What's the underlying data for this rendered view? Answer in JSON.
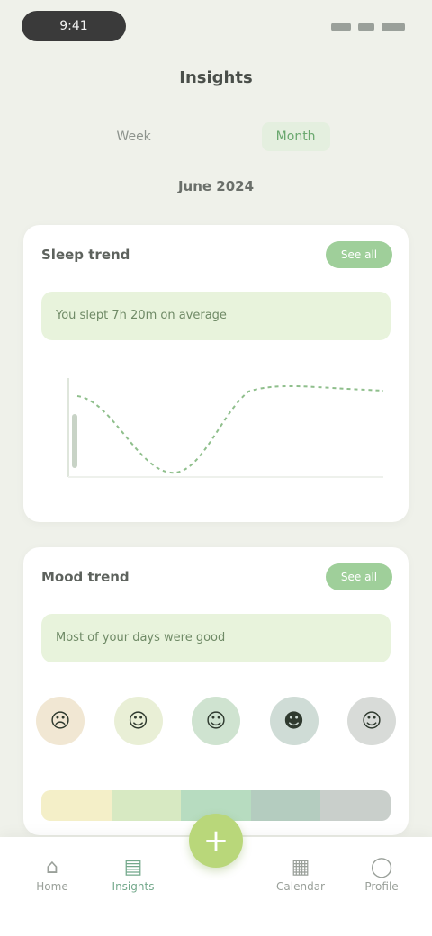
{
  "status_bar": {
    "time": "9:41"
  },
  "header": {
    "title": "Insights",
    "tabs": [
      {
        "label": "Week",
        "active": false
      },
      {
        "label": "Month",
        "active": true
      }
    ],
    "date_range": "June 2024"
  },
  "sleep_card": {
    "title": "Sleep trend",
    "badge": "See all",
    "insight": "You slept 7h 20m on average",
    "chart_type": "line",
    "line_color": "#8fbf8c"
  },
  "mood_card": {
    "title": "Mood trend",
    "badge": "See all",
    "insight": "Most of your days were good",
    "moods": [
      {
        "icon": "sad-face-icon",
        "glyph": "☹",
        "color": "#f1e7d3"
      },
      {
        "icon": "neutral-face-icon",
        "glyph": "😐",
        "color": "#e9efd6"
      },
      {
        "icon": "smile-face-icon",
        "glyph": "☺",
        "color": "#cfe3d0"
      },
      {
        "icon": "happy-face-icon",
        "glyph": "☻",
        "color": "#cfdcd6"
      },
      {
        "icon": "calm-face-icon",
        "glyph": "☺",
        "color": "#d8dbd8"
      }
    ],
    "scale_colors": [
      "#f4efc8",
      "#d7e9c2",
      "#b7dcc0",
      "#b4ccbf",
      "#c9cfcb"
    ]
  },
  "bottom_nav": {
    "items": [
      {
        "label": "Home",
        "icon": "home-icon",
        "glyph": "⌂",
        "active": false
      },
      {
        "label": "Insights",
        "icon": "chart-icon",
        "glyph": "▤",
        "active": true
      },
      {
        "label": "Calendar",
        "icon": "calendar-icon",
        "glyph": "▦",
        "active": false
      },
      {
        "label": "Profile",
        "icon": "profile-icon",
        "glyph": "◯",
        "active": false
      }
    ],
    "fab_glyph": "+"
  }
}
